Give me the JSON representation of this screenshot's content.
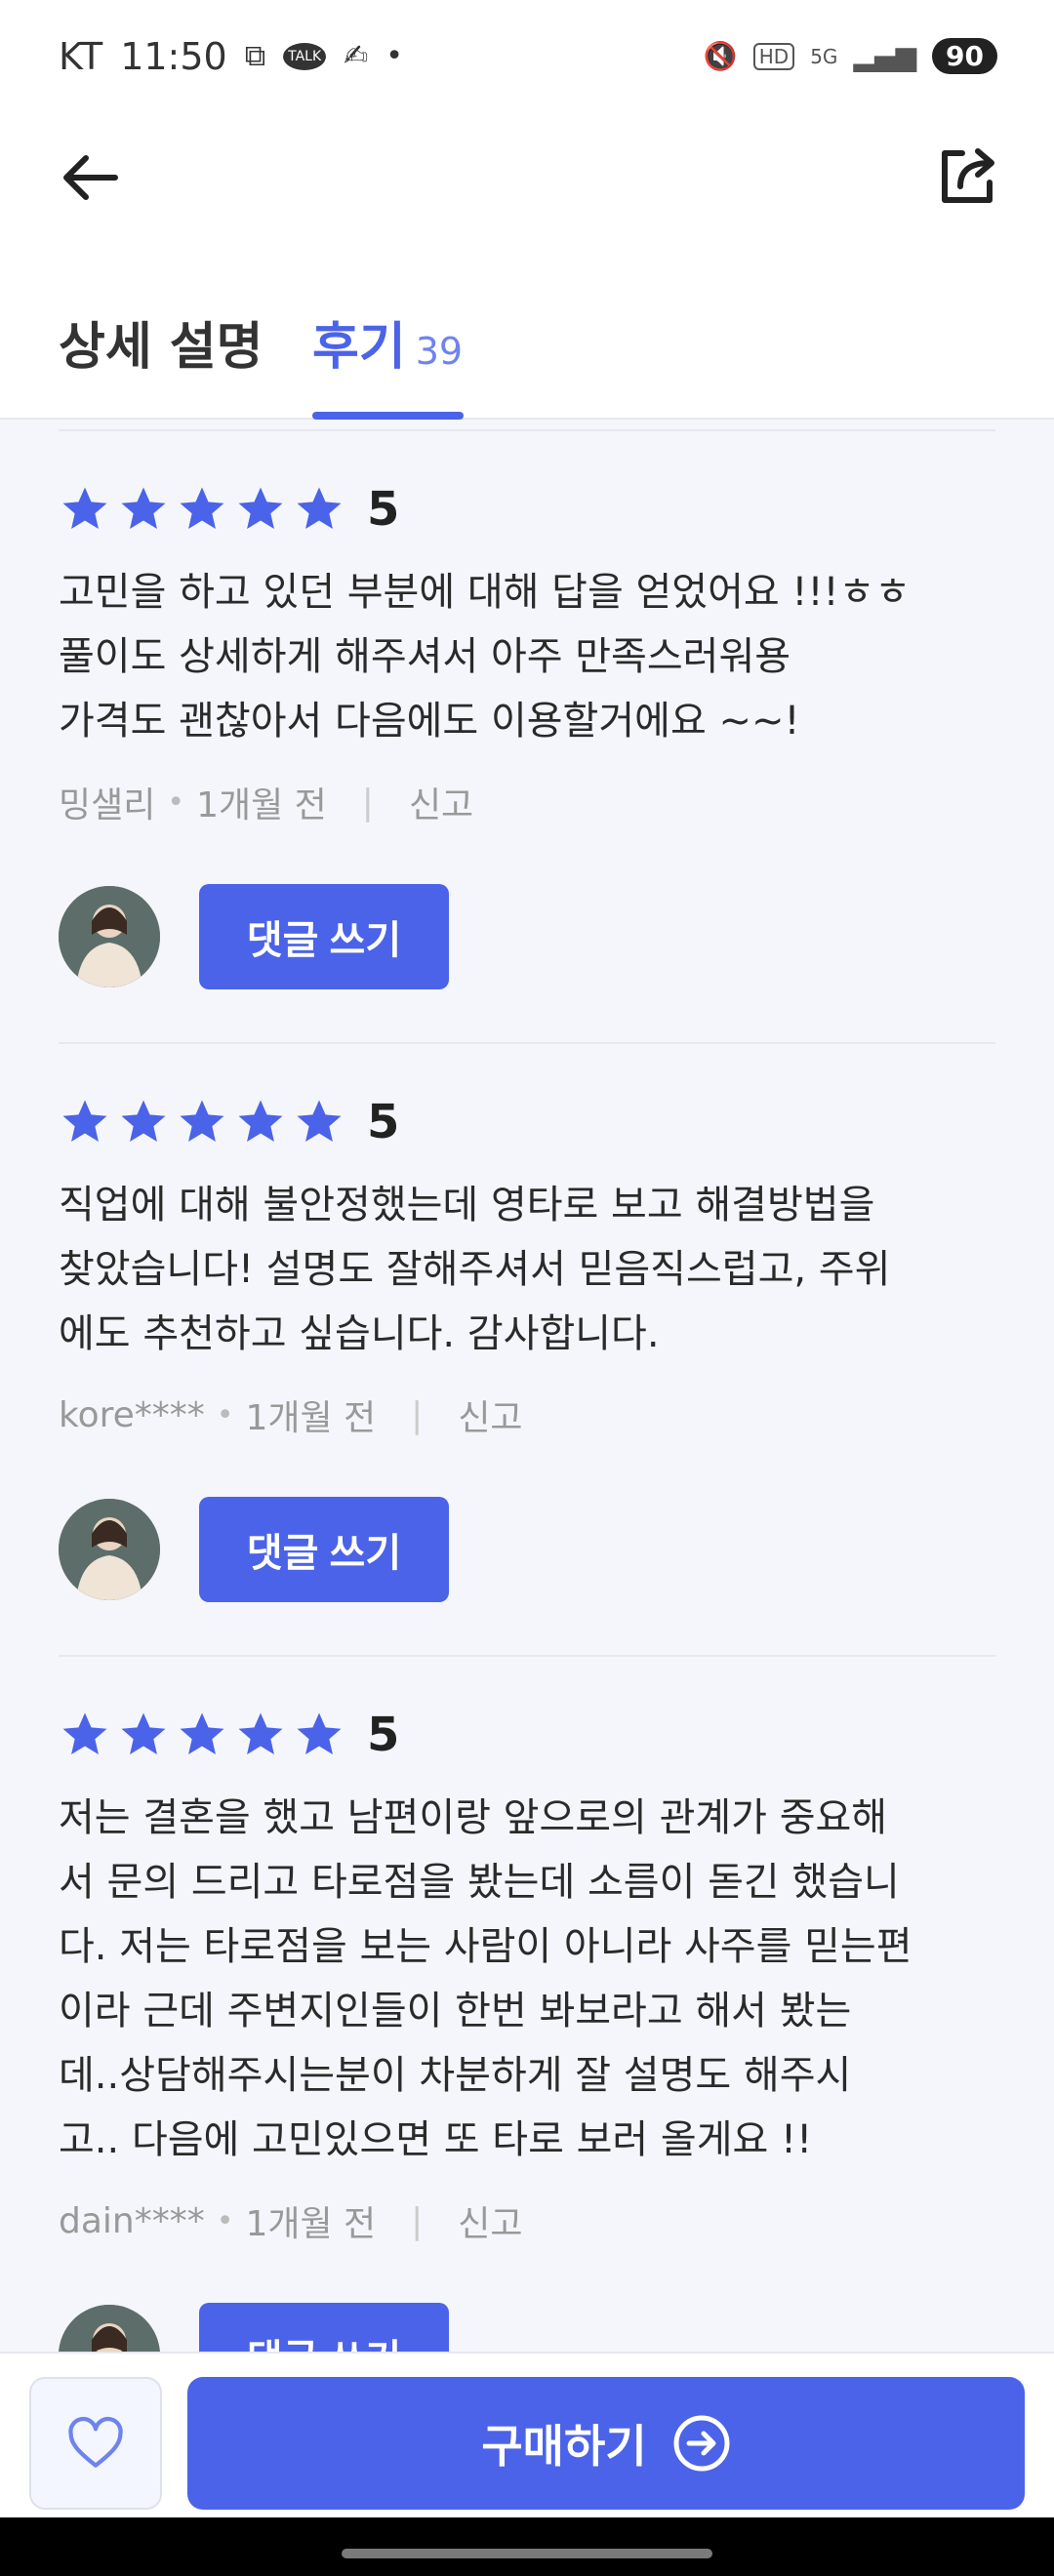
{
  "status_bar": {
    "carrier": "KT",
    "time": "11:50",
    "talk_badge": "TALK",
    "network": "5G",
    "hd": "HD",
    "battery": "90"
  },
  "tabs": {
    "description_label": "상세 설명",
    "reviews_label": "후기",
    "reviews_count": "39"
  },
  "reviews": [
    {
      "score": "5",
      "lines": [
        "고민을 하고 있던 부분에 대해 답을 얻었어요 !!!ㅎㅎ",
        "풀이도 상세하게 해주셔서 아주 만족스러워용",
        "가격도 괜찮아서 다음에도 이용할거에요 ~~!"
      ],
      "author": "밍샐리",
      "time": "1개월 전",
      "report": "신고",
      "reply_label": "댓글 쓰기"
    },
    {
      "score": "5",
      "lines": [
        "직업에 대해 불안정했는데 영타로 보고 해결방법을",
        "찾았습니다! 설명도 잘해주셔서 믿음직스럽고, 주위",
        "에도 추천하고 싶습니다. 감사합니다."
      ],
      "author": "kore****",
      "time": "1개월 전",
      "report": "신고",
      "reply_label": "댓글 쓰기"
    },
    {
      "score": "5",
      "lines": [
        "저는 결혼을 했고 남편이랑 앞으로의 관계가 중요해",
        "서 문의 드리고 타로점을 봤는데 소름이 돋긴 했습니",
        "다. 저는 타로점을 보는 사람이 아니라 사주를 믿는편",
        "이라 근데 주변지인들이 한번 봐보라고 해서 봤는",
        "데..상담해주시는분이 차분하게 잘 설명도 해주시",
        "고.. 다음에 고민있으면 또 타로 보러 올게요 !!"
      ],
      "author": "dain****",
      "time": "1개월 전",
      "report": "신고",
      "reply_label": "댓글 쓰기"
    }
  ],
  "bottom_bar": {
    "buy_label": "구매하기"
  },
  "colors": {
    "accent": "#4b63e8",
    "star": "#4b63e8",
    "divider": "#e6e8ef"
  }
}
